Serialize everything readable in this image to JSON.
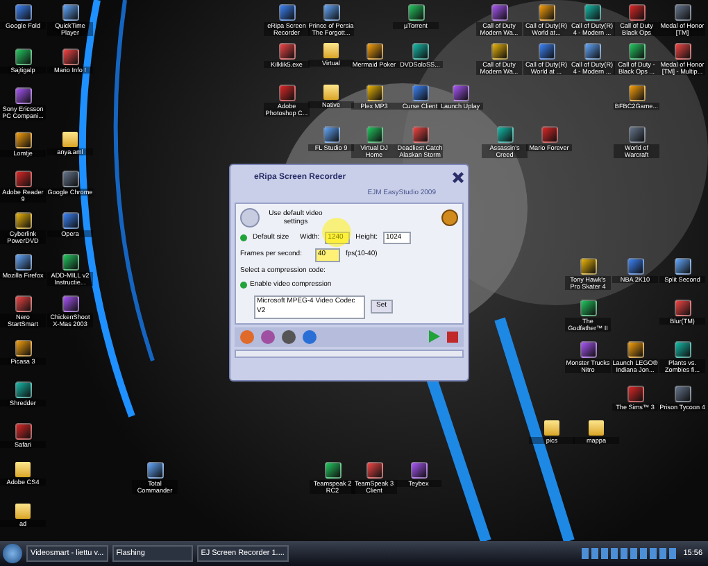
{
  "desktop_icons": [
    {
      "label": "Google Fold",
      "kind": "app"
    },
    {
      "label": "QuickTime Player",
      "kind": "app"
    },
    {
      "label": "Sajtigalp",
      "kind": "app"
    },
    {
      "label": "Mario Info !",
      "kind": "app"
    },
    {
      "label": "Sony Ericsson PC Compani...",
      "kind": "app"
    },
    {
      "label": "Lomtje",
      "kind": "app"
    },
    {
      "label": "anya.aml",
      "kind": "folder"
    },
    {
      "label": "Adobe Reader 9",
      "kind": "app"
    },
    {
      "label": "Google Chrome",
      "kind": "app"
    },
    {
      "label": "Cyberlink PowerDVD",
      "kind": "app"
    },
    {
      "label": "Opera",
      "kind": "app"
    },
    {
      "label": "Mozilla Firefox",
      "kind": "app"
    },
    {
      "label": "ADD-MILL v2 Instructie...",
      "kind": "app"
    },
    {
      "label": "Nero StartSmart",
      "kind": "app"
    },
    {
      "label": "ChickenShoot X-Mas 2003",
      "kind": "app"
    },
    {
      "label": "Picasa 3",
      "kind": "app"
    },
    {
      "label": "Shredder",
      "kind": "app"
    },
    {
      "label": "Safari",
      "kind": "app"
    },
    {
      "label": "Adobe CS4",
      "kind": "folder"
    },
    {
      "label": "ad",
      "kind": "folder"
    },
    {
      "label": "eRipa Screen Recorder",
      "kind": "app"
    },
    {
      "label": "Prince of Persia The Forgott...",
      "kind": "app"
    },
    {
      "label": "µTorrent",
      "kind": "app"
    },
    {
      "label": "Kilklik5.exe",
      "kind": "app"
    },
    {
      "label": "Virtual",
      "kind": "folder"
    },
    {
      "label": "Mermaid Poker",
      "kind": "app"
    },
    {
      "label": "DVDSoloSS...",
      "kind": "app"
    },
    {
      "label": "Adobe Photoshop C...",
      "kind": "app"
    },
    {
      "label": "Native",
      "kind": "folder"
    },
    {
      "label": "Plex MP3",
      "kind": "app"
    },
    {
      "label": "Curse Client",
      "kind": "app"
    },
    {
      "label": "FL Studio 9",
      "kind": "app"
    },
    {
      "label": "Virtual DJ Home",
      "kind": "app"
    },
    {
      "label": "Deadliest Catch Alaskan Storm",
      "kind": "app"
    },
    {
      "label": "Call of Duty Modern Wa...",
      "kind": "app"
    },
    {
      "label": "Call of Duty(R) World at...",
      "kind": "app"
    },
    {
      "label": "Call of Duty(R) 4 - Modern ...",
      "kind": "app"
    },
    {
      "label": "Call of Duty Black Ops",
      "kind": "app"
    },
    {
      "label": "Medal of Honor [TM]",
      "kind": "app"
    },
    {
      "label": "Call of Duty Modern Wa...",
      "kind": "app"
    },
    {
      "label": "Call of Duty(R) World at ...",
      "kind": "app"
    },
    {
      "label": "Call of Duty(R) 4 - Modern ...",
      "kind": "app"
    },
    {
      "label": "Call of Duty - Black Ops ...",
      "kind": "app"
    },
    {
      "label": "Medal of Honor [TM] - Multip...",
      "kind": "app"
    },
    {
      "label": "Launch Uplay",
      "kind": "app"
    },
    {
      "label": "BFBC2Game...",
      "kind": "app"
    },
    {
      "label": "Assassin's Creed",
      "kind": "app"
    },
    {
      "label": "Mario Forever",
      "kind": "app"
    },
    {
      "label": "World of Warcraft",
      "kind": "app"
    },
    {
      "label": "Tony Hawk's Pro Skater 4",
      "kind": "app"
    },
    {
      "label": "NBA 2K10",
      "kind": "app"
    },
    {
      "label": "Split Second",
      "kind": "app"
    },
    {
      "label": "The Godfather™ II",
      "kind": "app"
    },
    {
      "label": "Blur(TM)",
      "kind": "app"
    },
    {
      "label": "Monster Trucks Nitro",
      "kind": "app"
    },
    {
      "label": "Launch LEGO® Indiana Jon...",
      "kind": "app"
    },
    {
      "label": "Plants vs. Zombies fi...",
      "kind": "app"
    },
    {
      "label": "The Sims™ 3",
      "kind": "app"
    },
    {
      "label": "Prison Tycoon 4",
      "kind": "app"
    },
    {
      "label": "pics",
      "kind": "folder"
    },
    {
      "label": "mappa",
      "kind": "folder"
    },
    {
      "label": "Total Commander",
      "kind": "app"
    },
    {
      "label": "Teamspeak 2 RC2",
      "kind": "app"
    },
    {
      "label": "TeamSpeak 3 Client",
      "kind": "app"
    },
    {
      "label": "Teybex",
      "kind": "app"
    }
  ],
  "recorder": {
    "title": "eRipa Screen Recorder",
    "subtitle": "EJM EasyStudio 2009",
    "default_settings_label": "Use default video settings",
    "default_size_label": "Default size",
    "default_size_checked": true,
    "width_label": "Width:",
    "width_value": "1240",
    "height_label": "Height:",
    "height_value": "1024",
    "fps_label": "Frames per second:",
    "fps_value": "40",
    "fps_hint": "fps(10-40)",
    "compression_heading": "Select a compression code:",
    "compression_label": "Enable video compression",
    "compression_checked": true,
    "codec": "Microsoft MPEG-4 Video Codec V2",
    "set_button": "Set"
  },
  "taskbar": {
    "buttons": [
      {
        "label": "Videosmart - liettu v..."
      },
      {
        "label": "Flashing"
      },
      {
        "label": "EJ Screen Recorder 1...."
      }
    ],
    "clock": "15:56"
  }
}
